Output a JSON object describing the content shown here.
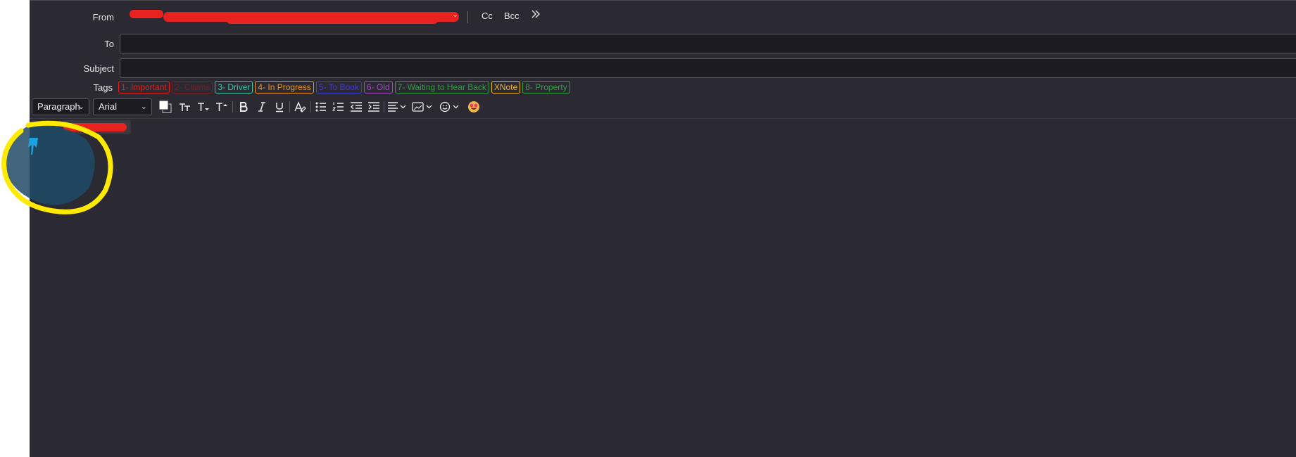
{
  "compose": {
    "from_label": "From",
    "to_label": "To",
    "subject_label": "Subject",
    "tags_label": "Tags",
    "cc_label": "Cc",
    "bcc_label": "Bcc",
    "more_icon": "double-chevron-right-icon",
    "to_value": "",
    "subject_value": ""
  },
  "tags": [
    {
      "label": "1- Important",
      "color": "#e0201c"
    },
    {
      "label": "2- Claims",
      "color": "#7a1f22"
    },
    {
      "label": "3- Driver",
      "color": "#3cc7a7"
    },
    {
      "label": "4- In Progress",
      "color": "#f2951b"
    },
    {
      "label": "5- To Book",
      "color": "#3d3dd6"
    },
    {
      "label": "6- Old",
      "color": "#a24bbf"
    },
    {
      "label": "7- Waiting to Hear Back",
      "color": "#2f9f3f"
    },
    {
      "label": "XNote",
      "color": "#f5b72a"
    },
    {
      "label": "8- Property",
      "color": "#2f9f3f"
    }
  ],
  "toolbar": {
    "paragraph_format": "Paragraph",
    "font_family": "Arial",
    "text_color": "#ffffff",
    "icons": [
      "font-size-icon",
      "decrease-font-size-icon",
      "increase-font-size-icon",
      "bold-icon",
      "italic-icon",
      "underline-icon",
      "clear-formatting-icon",
      "bullet-list-icon",
      "numbered-list-icon",
      "outdent-icon",
      "indent-icon",
      "align-icon",
      "insert-image-icon",
      "emoji-icon",
      "emoji-face-icon"
    ]
  },
  "colors": {
    "background": "#2b2a33",
    "input_bg": "#1c1b22",
    "annotation": "#ffea00",
    "redaction": "#e8231f"
  }
}
